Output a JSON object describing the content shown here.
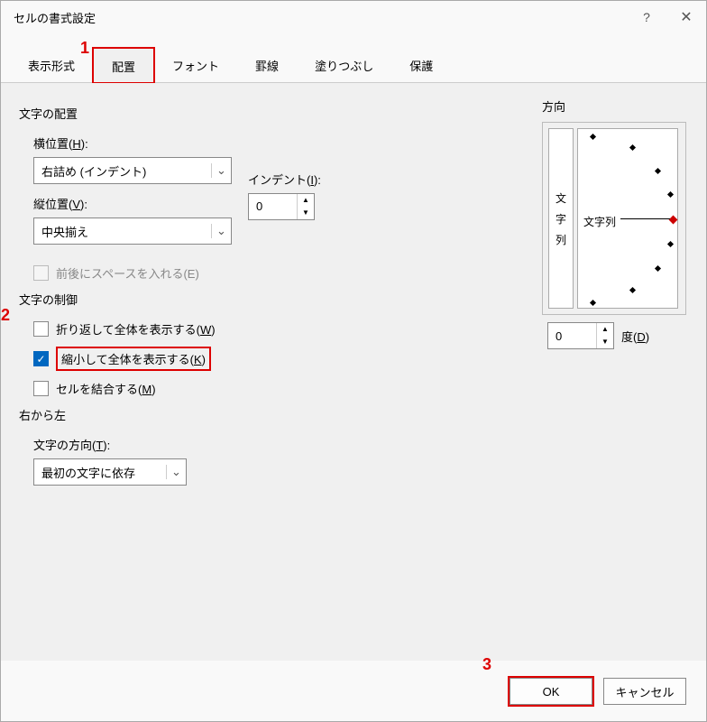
{
  "dialog": {
    "title": "セルの書式設定"
  },
  "tabs": [
    "表示形式",
    "配置",
    "フォント",
    "罫線",
    "塗りつぶし",
    "保護"
  ],
  "markers": {
    "m1": "1",
    "m2": "2",
    "m3": "3"
  },
  "alignment": {
    "group_label": "文字の配置",
    "horizontal_label_pre": "横位置(",
    "horizontal_key": "H",
    "horizontal_label_post": "):",
    "horizontal_value": "右詰め (インデント)",
    "vertical_label_pre": "縦位置(",
    "vertical_key": "V",
    "vertical_label_post": "):",
    "vertical_value": "中央揃え",
    "indent_label_pre": "インデント(",
    "indent_key": "I",
    "indent_label_post": "):",
    "indent_value": "0",
    "space_label": "前後にスペースを入れる(E)"
  },
  "control": {
    "group_label": "文字の制御",
    "wrap_pre": "折り返して全体を表示する(",
    "wrap_key": "W",
    "wrap_post": ")",
    "shrink_pre": "縮小して全体を表示する(",
    "shrink_key": "K",
    "shrink_post": ")",
    "merge_pre": "セルを結合する(",
    "merge_key": "M",
    "merge_post": ")"
  },
  "rtl": {
    "group_label": "右から左",
    "dir_label_pre": "文字の方向(",
    "dir_key": "T",
    "dir_label_post": "):",
    "dir_value": "最初の文字に依存"
  },
  "orientation": {
    "label": "方向",
    "vert_chars": [
      "文",
      "字",
      "列"
    ],
    "dial_text_pre": "文字列",
    "degree_value": "0",
    "degree_label_pre": "度(",
    "degree_key": "D",
    "degree_label_post": ")"
  },
  "buttons": {
    "ok": "OK",
    "cancel": "キャンセル"
  }
}
